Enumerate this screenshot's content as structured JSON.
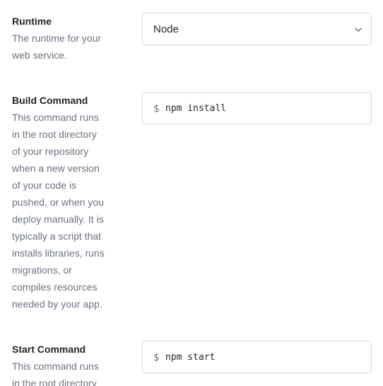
{
  "runtime": {
    "title": "Runtime",
    "description": "The runtime for your\nweb service.",
    "selected": "Node",
    "icon": "chevron-down-icon"
  },
  "build": {
    "title": "Build Command",
    "description": "This command runs\nin the root directory\nof your repository\nwhen a new version\nof your code is\npushed, or when you\ndeploy manually. It is\ntypically a script that\ninstalls libraries, runs\nmigrations, or\ncompiles resources\nneeded by your app.",
    "prompt": "$",
    "value": "npm install"
  },
  "start": {
    "title": "Start Command",
    "description": "This command runs\nin the root directory",
    "prompt": "$",
    "value": "npm start"
  }
}
